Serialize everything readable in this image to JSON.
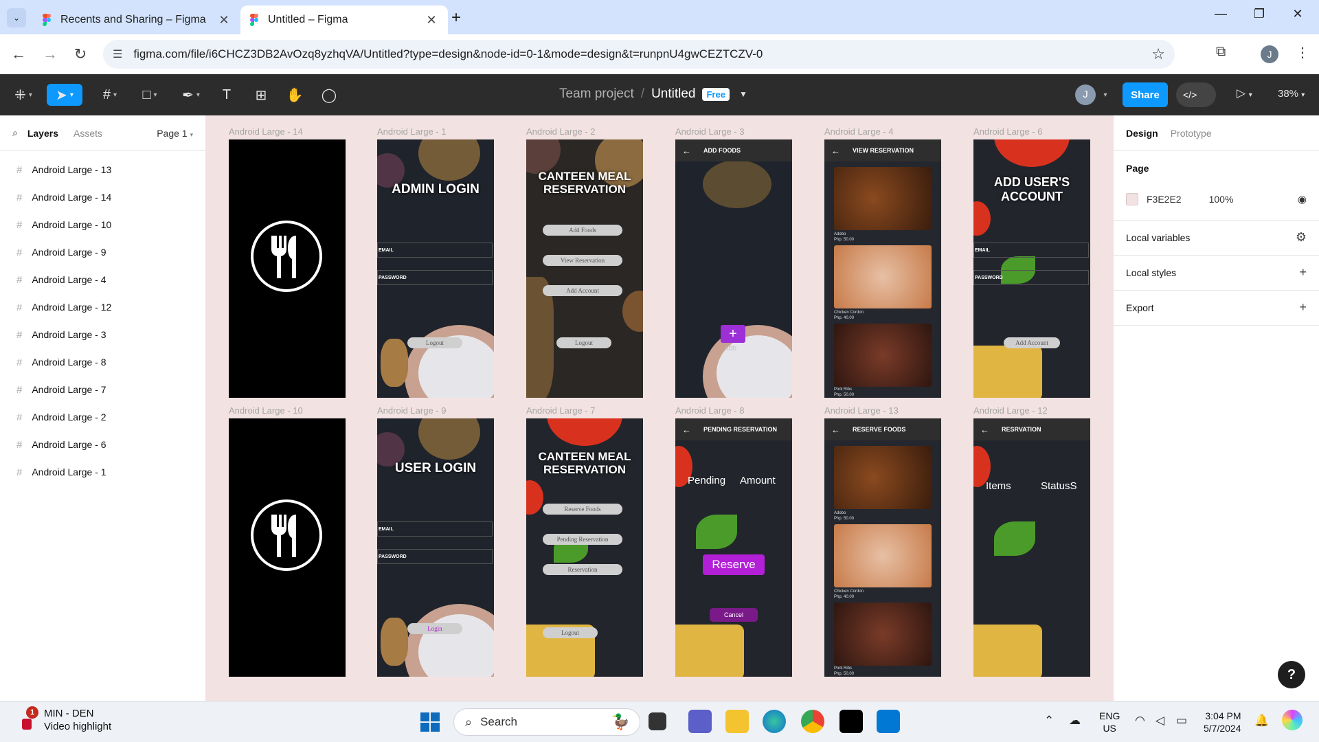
{
  "browser": {
    "tabs": [
      {
        "title": "Recents and Sharing – Figma",
        "active": false
      },
      {
        "title": "Untitled – Figma",
        "active": true
      }
    ],
    "url": "figma.com/file/i6CHCZ3DB2AvOzq8yzhqVA/Untitled?type=design&node-id=0-1&mode=design&t=runpnU4gwCEZTCZV-0",
    "profile_initial": "J"
  },
  "toolbar": {
    "project": "Team project",
    "file_name": "Untitled",
    "plan_badge": "Free",
    "user_initial": "J",
    "share_label": "Share",
    "zoom": "38%"
  },
  "left_panel": {
    "tab_layers": "Layers",
    "tab_assets": "Assets",
    "page_select": "Page 1",
    "layers": [
      "Android Large - 13",
      "Android Large - 14",
      "Android Large - 10",
      "Android Large - 9",
      "Android Large - 4",
      "Android Large - 12",
      "Android Large - 3",
      "Android Large - 8",
      "Android Large - 7",
      "Android Large - 2",
      "Android Large - 6",
      "Android Large - 1"
    ]
  },
  "canvas": {
    "frames": {
      "f14": {
        "label": "Android Large - 14"
      },
      "f1": {
        "label": "Android Large - 1",
        "title": "ADMIN LOGIN",
        "email": "EMAIL",
        "password": "PASSWORD",
        "button": "Logout"
      },
      "f2": {
        "label": "Android Large - 2",
        "title": "CANTEEN MEAL RESERVATION",
        "buttons": [
          "Add Foods",
          "View Reservation",
          "Add Account",
          "Logout"
        ]
      },
      "f3": {
        "label": "Android Large - 3",
        "header": "ADD FOODS",
        "add_text": "ADD"
      },
      "f4": {
        "label": "Android Large - 4",
        "header": "VIEW RESERVATION",
        "foods": [
          {
            "name": "Adobo",
            "price": "Php. 50.00"
          },
          {
            "name": "Chicken Cordon",
            "price": "Php. 40.00"
          },
          {
            "name": "Pork Ribs",
            "price": "Php. 50.00"
          }
        ]
      },
      "f6": {
        "label": "Android Large - 6",
        "title": "ADD USER'S ACCOUNT",
        "email": "EMAIL",
        "password": "PASSWORD",
        "button": "Add Account"
      },
      "f10": {
        "label": "Android Large - 10"
      },
      "f9": {
        "label": "Android Large - 9",
        "title": "USER LOGIN",
        "email": "EMAIL",
        "password": "PASSWORD",
        "button": "Login"
      },
      "f7": {
        "label": "Android Large - 7",
        "title": "CANTEEN MEAL RESERVATION",
        "buttons": [
          "Reserve Foods",
          "Pending Reservation",
          "Reservation",
          "Logout"
        ]
      },
      "f8": {
        "label": "Android Large - 8",
        "header": "PENDING RESERVATION",
        "col1": "Pending",
        "col2": "Amount",
        "reserve": "Reserve",
        "cancel": "Cancel"
      },
      "f13": {
        "label": "Android Large - 13",
        "header": "RESERVE FOODS",
        "foods": [
          {
            "name": "Adobo",
            "price": "Php. 50.00"
          },
          {
            "name": "Chicken Cordon",
            "price": "Php. 40.00"
          },
          {
            "name": "Pork Ribs",
            "price": "Php. 50.00"
          }
        ]
      },
      "f12": {
        "label": "Android Large - 12",
        "header": "RESRVATION",
        "col1": "Items",
        "col2": "StatusS"
      }
    }
  },
  "right_panel": {
    "tab_design": "Design",
    "tab_prototype": "Prototype",
    "page_heading": "Page",
    "page_color": "F3E2E2",
    "page_opacity": "100%",
    "local_variables": "Local variables",
    "local_styles": "Local styles",
    "export": "Export"
  },
  "taskbar": {
    "notification_count": "1",
    "weather_title": "MIN - DEN",
    "weather_sub": "Video highlight",
    "search_placeholder": "Search",
    "lang_top": "ENG",
    "lang_bottom": "US",
    "time": "3:04 PM",
    "date": "5/7/2024"
  },
  "colors": {
    "figma_blue": "#0d99ff",
    "canvas_bg": "#f3e2e2",
    "reserve_purple": "#b21fd6"
  }
}
